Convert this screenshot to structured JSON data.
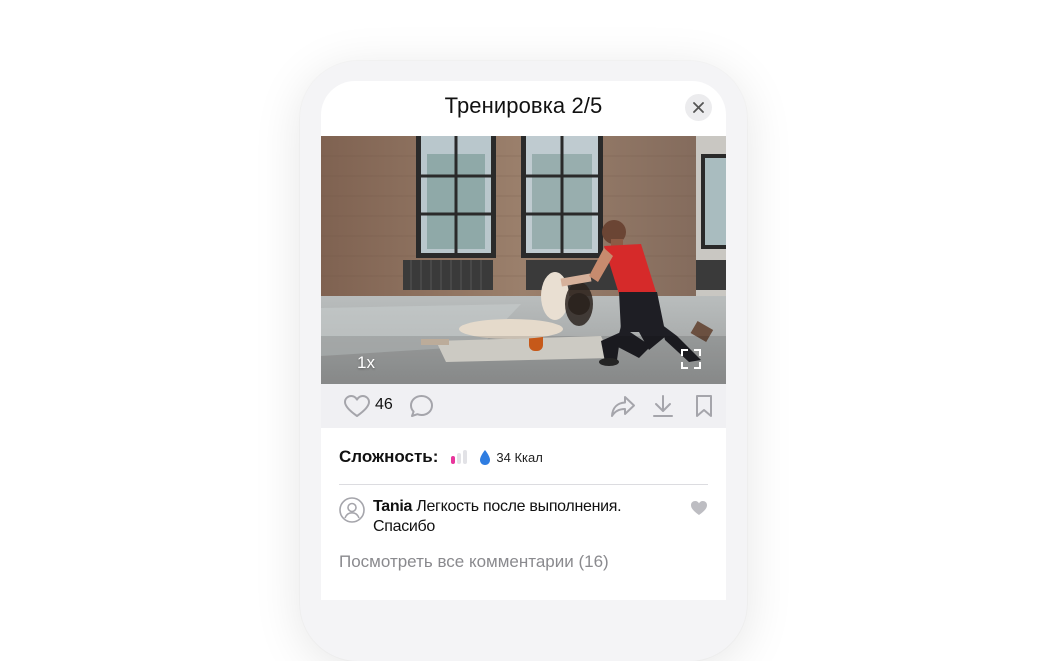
{
  "header": {
    "title": "Тренировка 2/5"
  },
  "video": {
    "speed_label": "1x"
  },
  "actions": {
    "like_count": "46"
  },
  "info": {
    "difficulty_label": "Сложность:",
    "difficulty_level": 1,
    "difficulty_max": 3,
    "calories": "34 Ккал"
  },
  "comment": {
    "author": "Tania",
    "text": " Легкость после выполнения. Спасибо"
  },
  "view_all_comments": "Посмотреть все комментарии (16)",
  "colors": {
    "accent_pink": "#e8359c",
    "inactive_bar": "#e2e2e6",
    "drop_blue": "#2f7de1",
    "icon_gray": "#a5a5ab"
  },
  "icons": [
    "close-icon",
    "fullscreen-icon",
    "heart-icon",
    "comment-icon",
    "share-icon",
    "download-icon",
    "bookmark-icon",
    "drop-icon",
    "avatar-icon"
  ]
}
